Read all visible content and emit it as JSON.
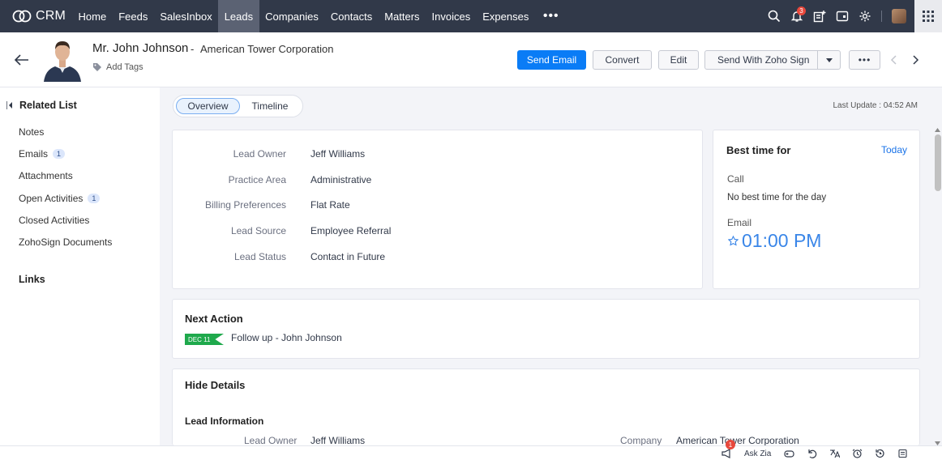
{
  "brand": {
    "name": "CRM"
  },
  "nav": {
    "items": [
      {
        "label": "Home"
      },
      {
        "label": "Feeds"
      },
      {
        "label": "SalesInbox"
      },
      {
        "label": "Leads"
      },
      {
        "label": "Companies"
      },
      {
        "label": "Contacts"
      },
      {
        "label": "Matters"
      },
      {
        "label": "Invoices"
      },
      {
        "label": "Expenses"
      }
    ],
    "active": "Leads",
    "more": "•••",
    "notification_count": "3"
  },
  "header": {
    "name": "Mr. John Johnson",
    "separator": "-",
    "company": "American Tower Corporation",
    "add_tags": "Add Tags",
    "buttons": {
      "send_email": "Send Email",
      "convert": "Convert",
      "edit": "Edit",
      "send_zoho_sign": "Send With Zoho Sign",
      "more": "•••"
    }
  },
  "sidebar": {
    "title": "Related List",
    "items": [
      {
        "label": "Notes",
        "count": ""
      },
      {
        "label": "Emails",
        "count": "1"
      },
      {
        "label": "Attachments",
        "count": ""
      },
      {
        "label": "Open Activities",
        "count": "1"
      },
      {
        "label": "Closed Activities",
        "count": ""
      },
      {
        "label": "ZohoSign Documents",
        "count": ""
      }
    ],
    "links_title": "Links"
  },
  "tabs": [
    {
      "label": "Overview"
    },
    {
      "label": "Timeline"
    }
  ],
  "last_update": "Last Update : 04:52 AM",
  "overview": {
    "fields": [
      {
        "label": "Lead Owner",
        "value": "Jeff Williams"
      },
      {
        "label": "Practice Area",
        "value": "Administrative"
      },
      {
        "label": "Billing Preferences",
        "value": "Flat Rate"
      },
      {
        "label": "Lead Source",
        "value": "Employee Referral"
      },
      {
        "label": "Lead Status",
        "value": "Contact in Future"
      }
    ]
  },
  "best_time": {
    "title": "Best time for",
    "today": "Today",
    "call_label": "Call",
    "call_text": "No best time for the day",
    "email_label": "Email",
    "email_time": "01:00 PM"
  },
  "next_action": {
    "title": "Next Action",
    "date": "DEC 11",
    "text": "Follow up - John Johnson"
  },
  "details": {
    "title": "Hide Details",
    "section": "Lead Information",
    "lead_owner_label": "Lead Owner",
    "lead_owner_value": "Jeff Williams",
    "company_label": "Company",
    "company_value": "American Tower Corporation"
  },
  "bottombar": {
    "ask_zia": "Ask Zia",
    "badge": "1"
  },
  "colors": {
    "nav_bg": "#313949",
    "primary": "#0a7cf6",
    "link": "#1a73e8",
    "tag_green": "#1fa94c",
    "badge_red": "#e8483c"
  }
}
